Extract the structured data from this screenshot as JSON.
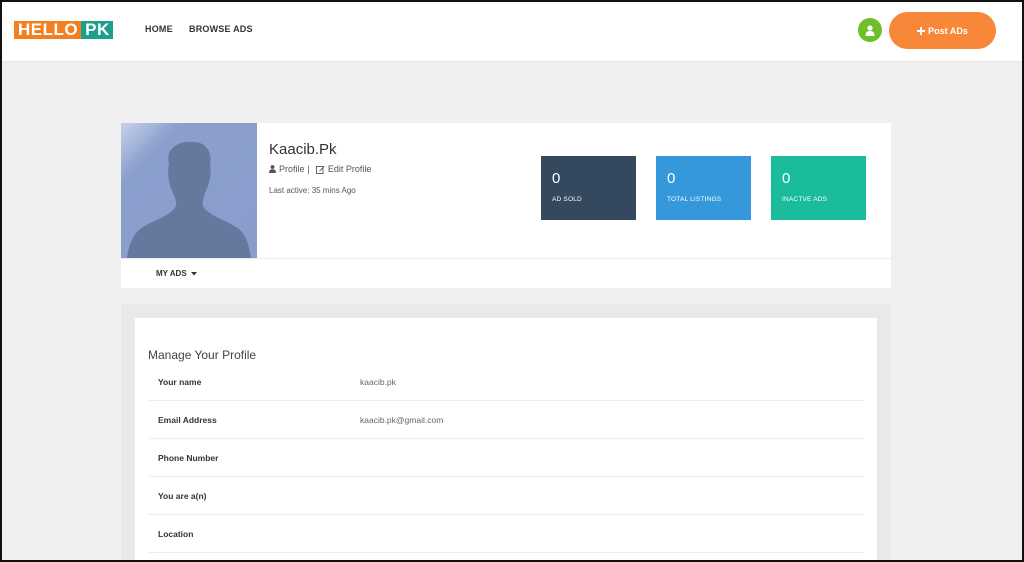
{
  "header": {
    "logo_part1": "HELLO",
    "logo_part2": "PK",
    "nav": [
      "HOME",
      "BROWSE ADS"
    ],
    "post_button": "Post ADs",
    "user_icon": "user-icon",
    "plus_icon": "plus-icon"
  },
  "profile": {
    "name": "Kaacib.Pk",
    "profile_link": "Profile",
    "separator": "|",
    "edit_link": "Edit Profile",
    "last_active": "Last active: 35 mins Ago"
  },
  "stats": [
    {
      "value": "0",
      "label": "AD SOLD",
      "color": "#34495e"
    },
    {
      "value": "0",
      "label": "TOTAL LISTINGS",
      "color": "#3498db"
    },
    {
      "value": "0",
      "label": "INACTVE ADS",
      "color": "#1abc9c"
    }
  ],
  "tabs": {
    "my_ads": "MY ADS"
  },
  "manage": {
    "title": "Manage Your Profile",
    "fields": [
      {
        "label": "Your name",
        "value": "kaacib.pk"
      },
      {
        "label": "Email Address",
        "value": "kaacib.pk@gmail.com"
      },
      {
        "label": "Phone Number",
        "value": ""
      },
      {
        "label": "You are a(n)",
        "value": ""
      },
      {
        "label": "Location",
        "value": ""
      }
    ]
  },
  "colors": {
    "brand_orange": "#f37f21",
    "brand_teal": "#1b9f8e",
    "post_button": "#f7883a",
    "user_button": "#6fbf2a"
  }
}
